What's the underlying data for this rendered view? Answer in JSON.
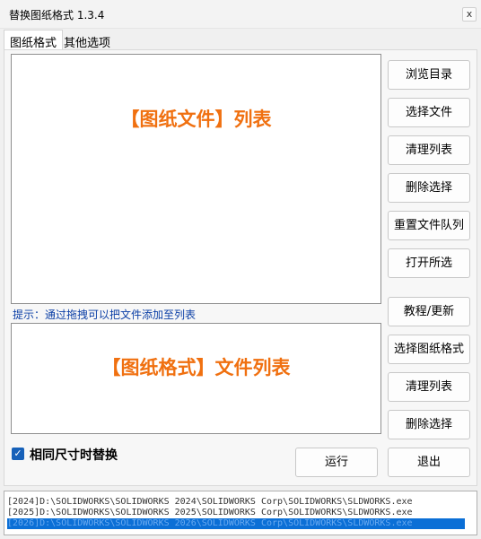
{
  "window": {
    "title": "替换图纸格式 1.3.4",
    "close_glyph": "x"
  },
  "tabs": [
    {
      "label": "图纸格式",
      "active": true
    },
    {
      "label": "其他选项",
      "active": false
    }
  ],
  "drawing_list": {
    "placeholder": "【图纸文件】列表"
  },
  "hint": "提示：通过拖拽可以把文件添加至列表",
  "format_list": {
    "placeholder": "【图纸格式】文件列表"
  },
  "buttons_top": {
    "browse": "浏览目录",
    "select_files": "选择文件",
    "clear_list": "清理列表",
    "delete_selected": "删除选择",
    "reset_queue": "重置文件队列",
    "open_selected": "打开所选"
  },
  "buttons_bottom": {
    "tutorial": "教程/更新",
    "select_format": "选择图纸格式",
    "clear_list": "清理列表",
    "delete_selected": "删除选择"
  },
  "same_size_checkbox": {
    "label": "相同尺寸时替换",
    "checked": true,
    "glyph": "✓"
  },
  "run_button": "运行",
  "exit_button": "退出",
  "paths": [
    "[2024]D:\\SOLIDWORKS\\SOLIDWORKS 2024\\SOLIDWORKS Corp\\SOLIDWORKS\\SLDWORKS.exe",
    "[2025]D:\\SOLIDWORKS\\SOLIDWORKS 2025\\SOLIDWORKS Corp\\SOLIDWORKS\\SLDWORKS.exe",
    "[2026]D:\\SOLIDWORKS\\SOLIDWORKS 2026\\SOLIDWORKS Corp\\SOLIDWORKS\\SLDWORKS.exe"
  ],
  "colors": {
    "accent": "#f07010",
    "hint": "#0b3fa6",
    "selection": "#0b6fd6"
  }
}
